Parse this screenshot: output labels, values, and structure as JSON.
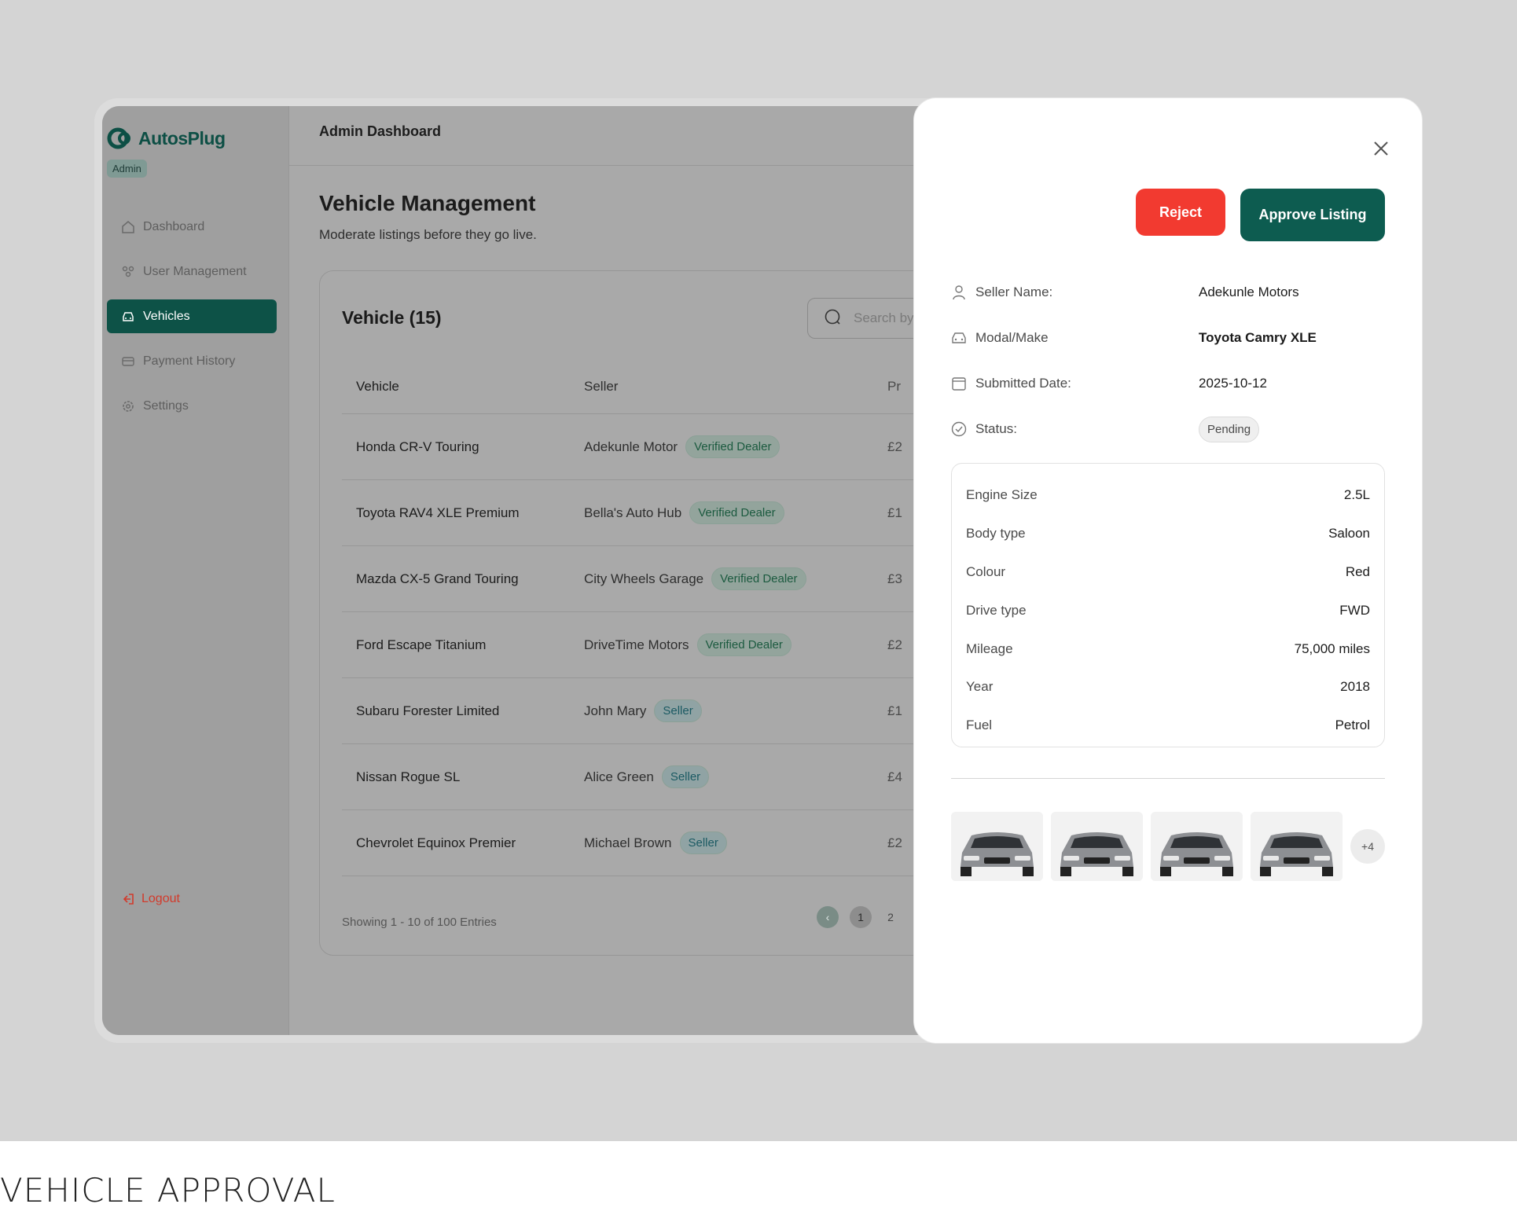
{
  "caption": "VEHICLE APPROVAL",
  "brand": {
    "name": "AutosPlug",
    "role": "Admin"
  },
  "sidebar": {
    "items": [
      {
        "label": "Dashboard",
        "icon": "home-icon"
      },
      {
        "label": "User Management",
        "icon": "users-icon"
      },
      {
        "label": "Vehicles",
        "icon": "car-icon",
        "active": true
      },
      {
        "label": "Payment History",
        "icon": "card-icon"
      },
      {
        "label": "Settings",
        "icon": "gear-icon"
      }
    ],
    "logout": "Logout"
  },
  "topbar": {
    "title": "Admin Dashboard"
  },
  "main": {
    "title": "Vehicle Management",
    "subtitle": "Moderate listings before they go live.",
    "card_title": "Vehicle (15)",
    "search_placeholder": "Search by",
    "columns": [
      "Vehicle",
      "Seller",
      "Pr"
    ],
    "rows": [
      {
        "vehicle": "Honda CR-V Touring",
        "seller": "Adekunle Motor",
        "badge": "Verified Dealer",
        "price": "£2"
      },
      {
        "vehicle": "Toyota RAV4 XLE Premium",
        "seller": "Bella's Auto Hub",
        "badge": "Verified Dealer",
        "price": "£1"
      },
      {
        "vehicle": "Mazda CX-5 Grand Touring",
        "seller": "City Wheels Garage",
        "badge": "Verified Dealer",
        "price": "£3"
      },
      {
        "vehicle": "Ford Escape Titanium",
        "seller": "DriveTime Motors",
        "badge": "Verified Dealer",
        "price": "£2"
      },
      {
        "vehicle": "Subaru Forester Limited",
        "seller": "John Mary",
        "badge": "Seller",
        "price": "£1"
      },
      {
        "vehicle": "Nissan Rogue SL",
        "seller": "Alice Green",
        "badge": "Seller",
        "price": "£4"
      },
      {
        "vehicle": "Chevrolet Equinox Premier",
        "seller": "Michael Brown",
        "badge": "Seller",
        "price": "£2"
      }
    ],
    "showing": "Showing 1 - 10 of 100 Entries",
    "pages": [
      "1",
      "2"
    ]
  },
  "modal": {
    "reject_label": "Reject",
    "approve_label": "Approve Listing",
    "info": {
      "seller_label": "Seller Name:",
      "seller_value": "Adekunle Motors",
      "model_label": "Modal/Make",
      "model_value": "Toyota Camry XLE",
      "date_label": "Submitted Date:",
      "date_value": "2025-10-12",
      "status_label": "Status:",
      "status_value": "Pending"
    },
    "specs": [
      {
        "label": "Engine Size",
        "value": "2.5L"
      },
      {
        "label": "Body type",
        "value": "Saloon"
      },
      {
        "label": "Colour",
        "value": "Red"
      },
      {
        "label": "Drive type",
        "value": "FWD"
      },
      {
        "label": "Mileage",
        "value": "75,000 miles"
      },
      {
        "label": "Year",
        "value": "2018"
      },
      {
        "label": "Fuel",
        "value": "Petrol"
      }
    ],
    "more_photos": "+4"
  },
  "colors": {
    "brand": "#0d5247",
    "reject": "#f23a30",
    "approve": "#0d5c50",
    "overlay": "#a9a9a9"
  }
}
